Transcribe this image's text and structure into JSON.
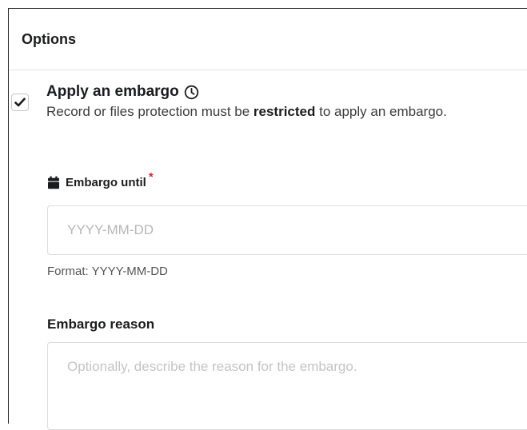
{
  "card": {
    "title": "Options"
  },
  "embargo": {
    "checked": true,
    "title": "Apply an embargo",
    "desc_before": "Record or files protection must be ",
    "desc_bold": "restricted",
    "desc_after": " to apply an embargo."
  },
  "embargo_until": {
    "label": "Embargo until",
    "required_mark": "*",
    "placeholder": "YYYY-MM-DD",
    "value": "",
    "hint": "Format: YYYY-MM-DD"
  },
  "embargo_reason": {
    "label": "Embargo reason",
    "placeholder": "Optionally, describe the reason for the embargo.",
    "value": ""
  },
  "icons": {
    "checkbox_check": "check-icon",
    "embargo_clock": "clock-icon",
    "calendar": "calendar-icon"
  },
  "colors": {
    "required": "#db2828",
    "text": "#1b1c1d",
    "border": "#dcdcdc"
  }
}
